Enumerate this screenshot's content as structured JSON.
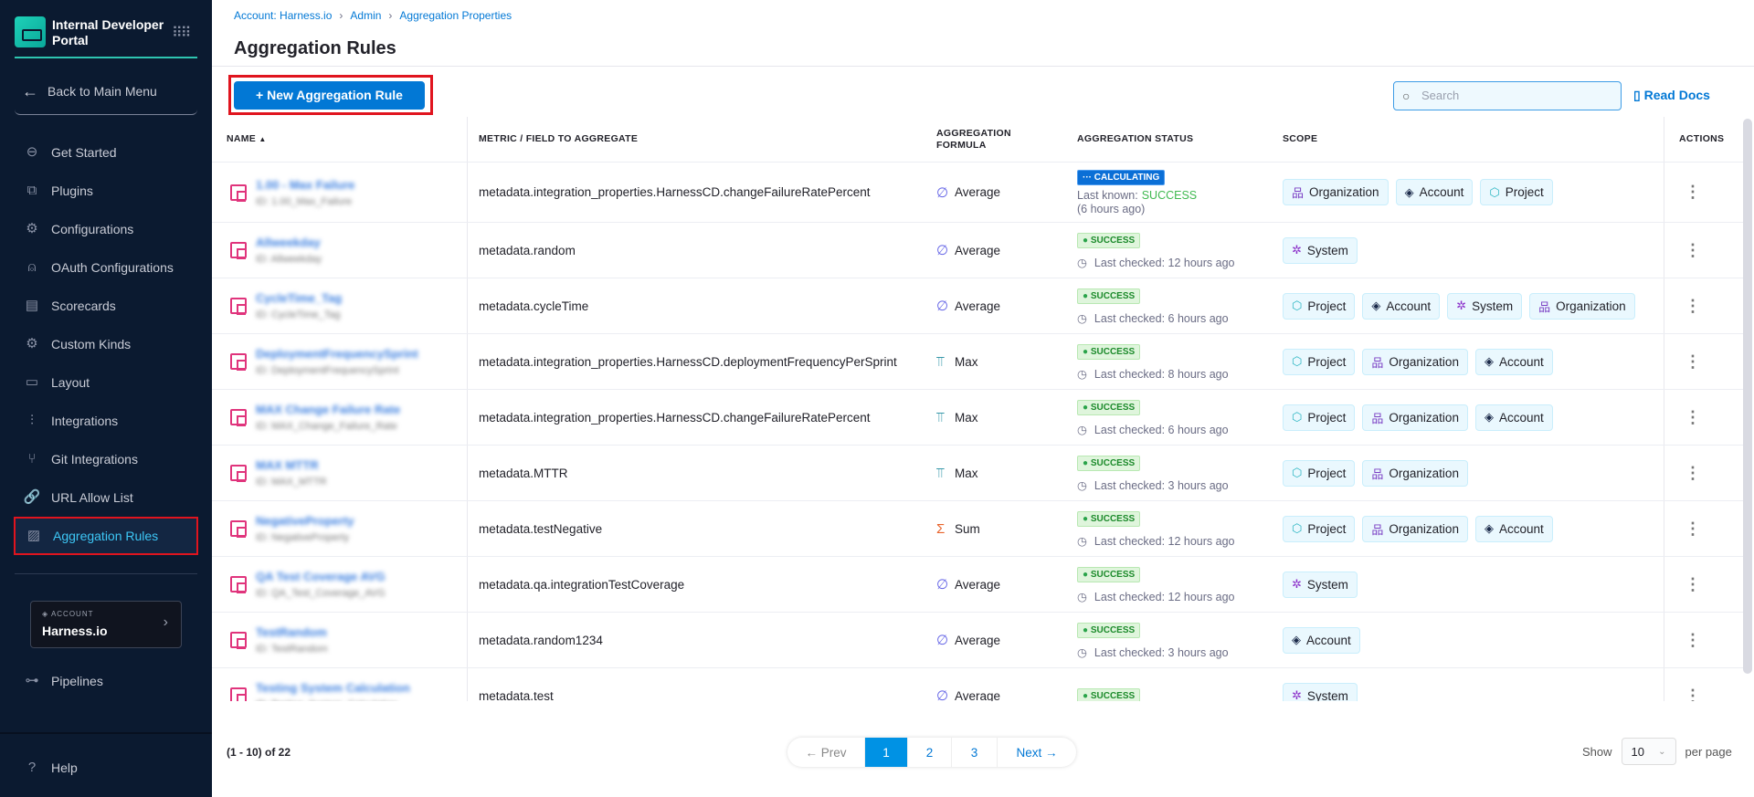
{
  "sidebar": {
    "app_name_1": "Internal Developer",
    "app_name_2": "Portal",
    "back": "Back to Main Menu",
    "items": [
      {
        "label": "Get Started",
        "icon": "get-started-icon",
        "glyph": "⊖"
      },
      {
        "label": "Plugins",
        "icon": "plugin-icon",
        "glyph": "⧉"
      },
      {
        "label": "Configurations",
        "icon": "gear-icon",
        "glyph": "⚙"
      },
      {
        "label": "OAuth Configurations",
        "icon": "oauth-icon",
        "glyph": "⍝"
      },
      {
        "label": "Scorecards",
        "icon": "scorecard-icon",
        "glyph": "▤"
      },
      {
        "label": "Custom Kinds",
        "icon": "custom-kinds-icon",
        "glyph": "⚙"
      },
      {
        "label": "Layout",
        "icon": "layout-icon",
        "glyph": "▭"
      },
      {
        "label": "Integrations",
        "icon": "integrations-icon",
        "glyph": "⫶"
      },
      {
        "label": "Git Integrations",
        "icon": "git-icon",
        "glyph": "⑂"
      },
      {
        "label": "URL Allow List",
        "icon": "link-icon",
        "glyph": "🔗"
      },
      {
        "label": "Aggregation Rules",
        "icon": "aggregation-icon",
        "glyph": "▨",
        "active": true
      }
    ],
    "account_label": "ACCOUNT",
    "account_name": "Harness.io",
    "pipelines": "Pipelines",
    "help": "Help"
  },
  "breadcrumb": [
    "Account: Harness.io",
    "Admin",
    "Aggregation Properties"
  ],
  "title": "Aggregation Rules",
  "toolbar": {
    "new_button": "+ New Aggregation Rule",
    "search_placeholder": "Search",
    "read_docs": "Read Docs"
  },
  "columns": {
    "name": "NAME",
    "metric": "METRIC / FIELD TO AGGREGATE",
    "formula": "AGGREGATION FORMULA",
    "status": "AGGREGATION STATUS",
    "scope": "SCOPE",
    "actions": "ACTIONS"
  },
  "rows": [
    {
      "name": "1.00 - Max Failure",
      "id": "ID: 1.00_Max_Failure",
      "metric": "metadata.integration_properties.HarnessCD.changeFailureRatePercent",
      "formula": "Average",
      "status": "CALCULATING",
      "last_known_label": "Last known:",
      "last_known": "SUCCESS",
      "ago": "(6 hours ago)",
      "scope": [
        "Organization",
        "Account",
        "Project"
      ]
    },
    {
      "name": "Allweekday",
      "id": "ID: Allweekday",
      "metric": "metadata.random",
      "formula": "Average",
      "status": "SUCCESS",
      "checked": "Last checked: 12 hours ago",
      "scope": [
        "System"
      ]
    },
    {
      "name": "CycleTime_Tag",
      "id": "ID: CycleTime_Tag",
      "metric": "metadata.cycleTime",
      "formula": "Average",
      "status": "SUCCESS",
      "checked": "Last checked: 6 hours ago",
      "scope": [
        "Project",
        "Account",
        "System",
        "Organization"
      ]
    },
    {
      "name": "DeploymentFrequencySprint",
      "id": "ID: DeploymentFrequencySprint",
      "metric": "metadata.integration_properties.HarnessCD.deploymentFrequencyPerSprint",
      "formula": "Max",
      "status": "SUCCESS",
      "checked": "Last checked: 8 hours ago",
      "scope": [
        "Project",
        "Organization",
        "Account"
      ]
    },
    {
      "name": "MAX Change Failure Rate",
      "id": "ID: MAX_Change_Failure_Rate",
      "metric": "metadata.integration_properties.HarnessCD.changeFailureRatePercent",
      "formula": "Max",
      "status": "SUCCESS",
      "checked": "Last checked: 6 hours ago",
      "scope": [
        "Project",
        "Organization",
        "Account"
      ]
    },
    {
      "name": "MAX MTTR",
      "id": "ID: MAX_MTTR",
      "metric": "metadata.MTTR",
      "formula": "Max",
      "status": "SUCCESS",
      "checked": "Last checked: 3 hours ago",
      "scope": [
        "Project",
        "Organization"
      ]
    },
    {
      "name": "NegativeProperty",
      "id": "ID: NegativeProperty",
      "metric": "metadata.testNegative",
      "formula": "Sum",
      "status": "SUCCESS",
      "checked": "Last checked: 12 hours ago",
      "scope": [
        "Project",
        "Organization",
        "Account"
      ]
    },
    {
      "name": "QA Test Coverage AVG",
      "id": "ID: QA_Test_Coverage_AVG",
      "metric": "metadata.qa.integrationTestCoverage",
      "formula": "Average",
      "status": "SUCCESS",
      "checked": "Last checked: 12 hours ago",
      "scope": [
        "System"
      ]
    },
    {
      "name": "TestRandom",
      "id": "ID: TestRandom",
      "metric": "metadata.random1234",
      "formula": "Average",
      "status": "SUCCESS",
      "checked": "Last checked: 3 hours ago",
      "scope": [
        "Account"
      ]
    },
    {
      "name": "Testing System Calculation",
      "id": "ID: Testing_System_Calculation",
      "metric": "metadata.test",
      "formula": "Average",
      "status": "SUCCESS",
      "checked": "",
      "scope": [
        "System"
      ]
    }
  ],
  "formula_icons": {
    "Average": {
      "icon": "average-icon",
      "glyph": "∅",
      "color": "#6464e6"
    },
    "Max": {
      "icon": "max-icon",
      "glyph": "⫪",
      "color": "#1d8a9e"
    },
    "Sum": {
      "icon": "sum-icon",
      "glyph": "Σ",
      "color": "#e8632b"
    }
  },
  "scope_icons": {
    "Organization": {
      "icon": "organization-icon",
      "glyph": "品",
      "color": "#7b3fc4"
    },
    "Account": {
      "icon": "account-icon",
      "glyph": "◈",
      "color": "#1b2a4a"
    },
    "Project": {
      "icon": "project-icon",
      "glyph": "⬡",
      "color": "#2bb5c2"
    },
    "System": {
      "icon": "system-icon",
      "glyph": "✲",
      "color": "#8b2fc9"
    }
  },
  "footer": {
    "range": "(1 - 10) of 22",
    "prev": "← Prev",
    "pages": [
      "1",
      "2",
      "3"
    ],
    "current_page": "1",
    "next": "Next →",
    "show": "Show",
    "page_size": "10",
    "per_page": "per page"
  }
}
